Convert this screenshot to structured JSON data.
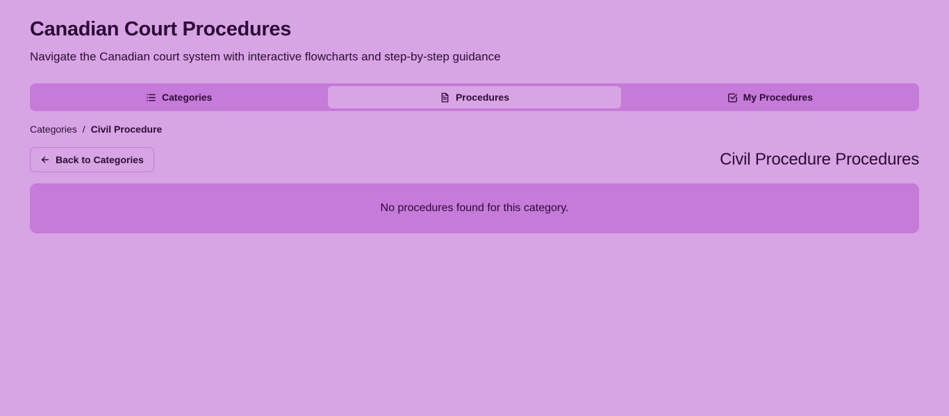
{
  "app": {
    "title": "Canadian Court Procedures",
    "subtitle": "Navigate the Canadian court system with interactive flowcharts and step-by-step guidance"
  },
  "tabs": [
    {
      "label": "Categories",
      "icon": "list-icon",
      "active": false
    },
    {
      "label": "Procedures",
      "icon": "document-icon",
      "active": true
    },
    {
      "label": "My Procedures",
      "icon": "checkbox-icon",
      "active": false
    }
  ],
  "breadcrumb": {
    "root": "Categories",
    "separator": "/",
    "current": "Civil Procedure"
  },
  "back_button": {
    "label": "Back to Categories",
    "icon": "arrow-left-icon"
  },
  "section": {
    "title": "Civil Procedure Procedures",
    "empty_message": "No procedures found for this category."
  },
  "colors": {
    "background": "#d8a5e4",
    "accent": "#c67ad9",
    "text": "#2b0a35"
  }
}
